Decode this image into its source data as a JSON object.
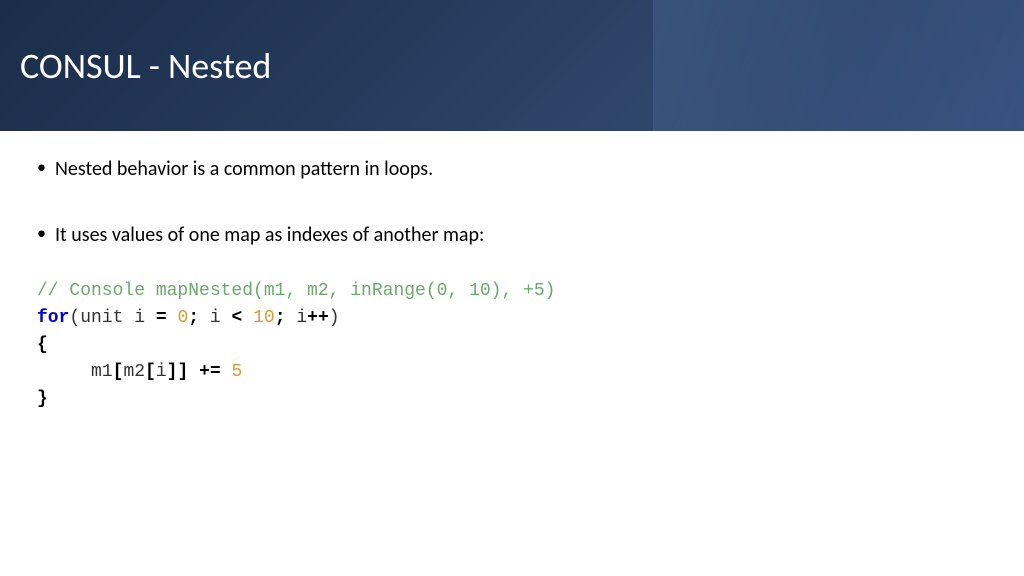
{
  "header": {
    "title": "CONSUL - Nested"
  },
  "bullets": [
    "Nested behavior is a common pattern in loops.",
    "It uses values of one map as indexes of another map:"
  ],
  "code": {
    "comment": "// Console mapNested(m1, m2, inRange(0, 10), +5)",
    "line1_for": "for",
    "line1_open": "(",
    "line1_unit": "unit i ",
    "line1_eq": "=",
    "line1_sp1": " ",
    "line1_zero": "0",
    "line1_semi1": ";",
    "line1_icond": " i ",
    "line1_lt": "<",
    "line1_sp2": " ",
    "line1_ten": "10",
    "line1_semi2": ";",
    "line1_iinc": " i",
    "line1_pp": "++",
    "line1_close": ")",
    "line2_brace": "{",
    "line3_indent": "     ",
    "line3_m1": "m1",
    "line3_lb1": "[",
    "line3_m2": "m2",
    "line3_lb2": "[",
    "line3_i": "i",
    "line3_rb2": "]",
    "line3_rb1": "]",
    "line3_sp": " ",
    "line3_pe": "+=",
    "line3_sp2": " ",
    "line3_five": "5",
    "line4_brace": "}"
  }
}
